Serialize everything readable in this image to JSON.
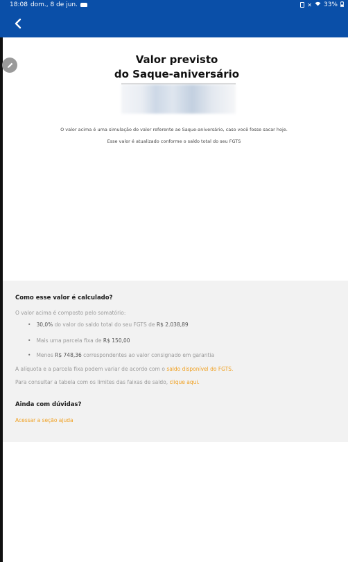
{
  "status_bar": {
    "time": "18:08",
    "date": "dom., 8 de jun.",
    "battery": "33%"
  },
  "header": {
    "back_icon": "chevron-left-icon"
  },
  "main": {
    "title_line1": "Valor previsto",
    "title_line2": "do Saque-aniversário",
    "simulation_note": "O valor acima é uma simulação do valor referente ao Saque-aniversário, caso você fosse sacar hoje.",
    "update_note": "Esse valor é atualizado conforme o saldo total do seu FGTS"
  },
  "calculation": {
    "title": "Como esse valor é calculado?",
    "intro": "O valor acima é composto pelo somatório:",
    "bullet1_strong": "30,0%",
    "bullet1_mid": " do valor do saldo total do seu FGTS de ",
    "bullet1_amount": "R$ 2.038,89",
    "bullet2_text": "Mais uma parcela fixa de ",
    "bullet2_amount": "R$ 150,00",
    "bullet3_prefix": "Menos ",
    "bullet3_amount": "R$ 748,36",
    "bullet3_text": " correspondentes ao valor consignado em garantia",
    "variance_text": "A alíquota e a parcela fixa podem variar de acordo com o ",
    "variance_link": "saldo disponível do FGTS.",
    "table_text": "Para consultar a tabela com os limites das faixas de saldo, ",
    "table_link": "clique aqui."
  },
  "help": {
    "title": "Ainda com dúvidas?",
    "link": "Acessar a seção ajuda"
  },
  "colors": {
    "brand_blue": "#0a4fa8",
    "accent_orange": "#f0a020"
  }
}
